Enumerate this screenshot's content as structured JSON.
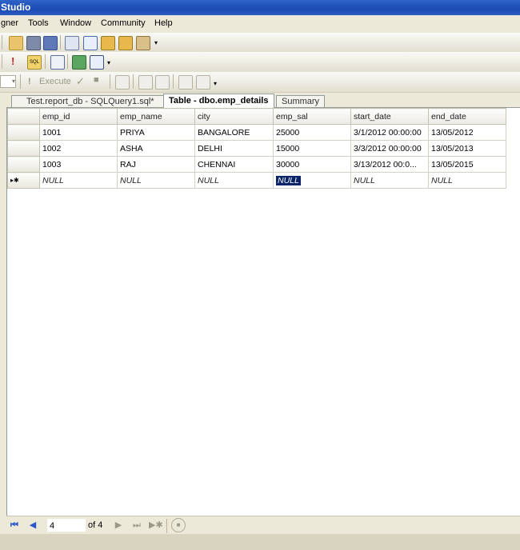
{
  "window": {
    "title": "Studio"
  },
  "menu": [
    "gner",
    "Tools",
    "Window",
    "Community",
    "Help"
  ],
  "toolbar3": {
    "execute_label": "Execute"
  },
  "tabs": [
    {
      "label": "Test.report_db - SQLQuery1.sql*",
      "active": false
    },
    {
      "label": "Table - dbo.emp_details",
      "active": true
    },
    {
      "label": "Summary",
      "active": false
    }
  ],
  "grid": {
    "columns": [
      "emp_id",
      "emp_name",
      "city",
      "emp_sal",
      "start_date",
      "end_date"
    ],
    "rows": [
      [
        "1001",
        "PRIYA",
        "BANGALORE",
        "25000",
        "3/1/2012 00:00:00",
        "13/05/2012"
      ],
      [
        "1002",
        "ASHA",
        "DELHI",
        "15000",
        "3/3/2012 00:00:00",
        "13/05/2013"
      ],
      [
        "1003",
        "RAJ",
        "CHENNAI",
        "30000",
        "3/13/2012 00:0...",
        "13/05/2015"
      ]
    ],
    "new_row": [
      "NULL",
      "NULL",
      "NULL",
      "NULL",
      "NULL",
      "NULL"
    ],
    "new_row_marker": "▸✱"
  },
  "navigator": {
    "current": "4",
    "of_label": "of 4"
  },
  "colors": {
    "titlebar": "#1a4bb4",
    "selection": "#0a246a"
  }
}
